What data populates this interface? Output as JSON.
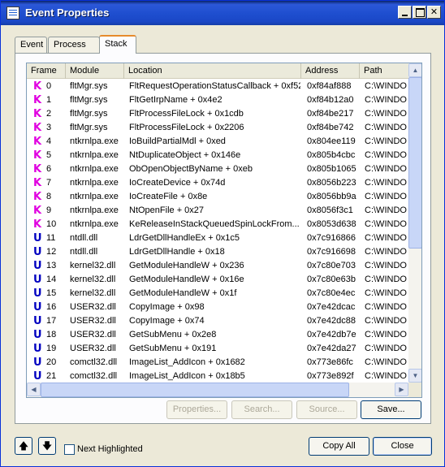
{
  "window": {
    "title": "Event Properties"
  },
  "tabs": [
    {
      "label": "Event",
      "active": false
    },
    {
      "label": "Process",
      "active": false
    },
    {
      "label": "Stack",
      "active": true
    }
  ],
  "stack": {
    "columns": [
      "Frame",
      "Module",
      "Location",
      "Address",
      "Path"
    ],
    "rows": [
      {
        "kind": "K",
        "frame": "0",
        "module": "fltMgr.sys",
        "location": "FltRequestOperationStatusCallback + 0xf52",
        "address": "0xf84af888",
        "path": "C:\\WINDO"
      },
      {
        "kind": "K",
        "frame": "1",
        "module": "fltMgr.sys",
        "location": "FltGetIrpName + 0x4e2",
        "address": "0xf84b12a0",
        "path": "C:\\WINDO"
      },
      {
        "kind": "K",
        "frame": "2",
        "module": "fltMgr.sys",
        "location": "FltProcessFileLock + 0x1cdb",
        "address": "0xf84be217",
        "path": "C:\\WINDO"
      },
      {
        "kind": "K",
        "frame": "3",
        "module": "fltMgr.sys",
        "location": "FltProcessFileLock + 0x2206",
        "address": "0xf84be742",
        "path": "C:\\WINDO"
      },
      {
        "kind": "K",
        "frame": "4",
        "module": "ntkrnlpa.exe",
        "location": "IoBuildPartialMdl + 0xed",
        "address": "0x804ee119",
        "path": "C:\\WINDO"
      },
      {
        "kind": "K",
        "frame": "5",
        "module": "ntkrnlpa.exe",
        "location": "NtDuplicateObject + 0x146e",
        "address": "0x805b4cbc",
        "path": "C:\\WINDO"
      },
      {
        "kind": "K",
        "frame": "6",
        "module": "ntkrnlpa.exe",
        "location": "ObOpenObjectByName + 0xeb",
        "address": "0x805b1065",
        "path": "C:\\WINDO"
      },
      {
        "kind": "K",
        "frame": "7",
        "module": "ntkrnlpa.exe",
        "location": "IoCreateDevice + 0x74d",
        "address": "0x8056b223",
        "path": "C:\\WINDO"
      },
      {
        "kind": "K",
        "frame": "8",
        "module": "ntkrnlpa.exe",
        "location": "IoCreateFile + 0x8e",
        "address": "0x8056bb9a",
        "path": "C:\\WINDO"
      },
      {
        "kind": "K",
        "frame": "9",
        "module": "ntkrnlpa.exe",
        "location": "NtOpenFile + 0x27",
        "address": "0x8056f3c1",
        "path": "C:\\WINDO"
      },
      {
        "kind": "K",
        "frame": "10",
        "module": "ntkrnlpa.exe",
        "location": "KeReleaseInStackQueuedSpinLockFrom...",
        "address": "0x8053d638",
        "path": "C:\\WINDO"
      },
      {
        "kind": "U",
        "frame": "11",
        "module": "ntdll.dll",
        "location": "LdrGetDllHandleEx + 0x1c5",
        "address": "0x7c916866",
        "path": "C:\\WINDO"
      },
      {
        "kind": "U",
        "frame": "12",
        "module": "ntdll.dll",
        "location": "LdrGetDllHandle + 0x18",
        "address": "0x7c916698",
        "path": "C:\\WINDO"
      },
      {
        "kind": "U",
        "frame": "13",
        "module": "kernel32.dll",
        "location": "GetModuleHandleW + 0x236",
        "address": "0x7c80e703",
        "path": "C:\\WINDO"
      },
      {
        "kind": "U",
        "frame": "14",
        "module": "kernel32.dll",
        "location": "GetModuleHandleW + 0x16e",
        "address": "0x7c80e63b",
        "path": "C:\\WINDO"
      },
      {
        "kind": "U",
        "frame": "15",
        "module": "kernel32.dll",
        "location": "GetModuleHandleW + 0x1f",
        "address": "0x7c80e4ec",
        "path": "C:\\WINDO"
      },
      {
        "kind": "U",
        "frame": "16",
        "module": "USER32.dll",
        "location": "CopyImage + 0x98",
        "address": "0x7e42dcac",
        "path": "C:\\WINDO"
      },
      {
        "kind": "U",
        "frame": "17",
        "module": "USER32.dll",
        "location": "CopyImage + 0x74",
        "address": "0x7e42dc88",
        "path": "C:\\WINDO"
      },
      {
        "kind": "U",
        "frame": "18",
        "module": "USER32.dll",
        "location": "GetSubMenu + 0x2e8",
        "address": "0x7e42db7e",
        "path": "C:\\WINDO"
      },
      {
        "kind": "U",
        "frame": "19",
        "module": "USER32.dll",
        "location": "GetSubMenu + 0x191",
        "address": "0x7e42da27",
        "path": "C:\\WINDO"
      },
      {
        "kind": "U",
        "frame": "20",
        "module": "comctl32.dll",
        "location": "ImageList_AddIcon + 0x1682",
        "address": "0x773e86fc",
        "path": "C:\\WINDO"
      },
      {
        "kind": "U",
        "frame": "21",
        "module": "comctl32.dll",
        "location": "ImageList_AddIcon + 0x18b5",
        "address": "0x773e892f",
        "path": "C:\\WINDO"
      }
    ]
  },
  "panel_buttons": {
    "properties": "Properties...",
    "search": "Search...",
    "source": "Source...",
    "save": "Save..."
  },
  "footer": {
    "up_arrow": "🡅",
    "down_arrow": "🡇",
    "next_highlighted": "Next Highlighted",
    "copy_all": "Copy All",
    "close": "Close"
  },
  "colors": {
    "kernel_frame": "#e000e0",
    "user_frame": "#0000c0",
    "title_bar": "#1f4fd0"
  }
}
